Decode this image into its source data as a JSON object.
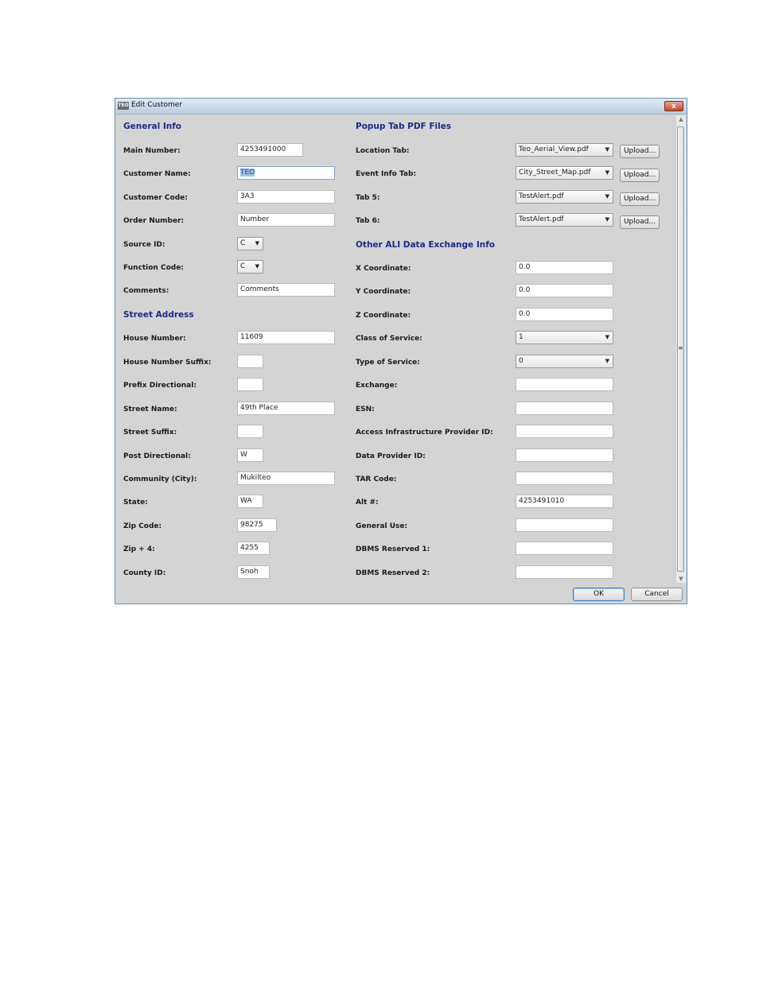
{
  "window": {
    "title": "Edit Customer",
    "icon_text": "TEO",
    "close": "x"
  },
  "general": {
    "heading": "General Info",
    "fields": [
      {
        "label": "Main Number:",
        "value": "4253491000"
      },
      {
        "label": "Customer Name:",
        "value": "TEO"
      },
      {
        "label": "Customer Code:",
        "value": "3A3"
      },
      {
        "label": "Order Number:",
        "value": "Number"
      },
      {
        "label": "Source ID:",
        "value": "C"
      },
      {
        "label": "Function Code:",
        "value": "C"
      },
      {
        "label": "Comments:",
        "value": "Comments"
      }
    ]
  },
  "street": {
    "heading": "Street Address",
    "fields": [
      {
        "label": "House Number:",
        "value": "11609"
      },
      {
        "label": "House Number Suffix:",
        "value": ""
      },
      {
        "label": "Prefix Directional:",
        "value": ""
      },
      {
        "label": "Street Name:",
        "value": "49th Place"
      },
      {
        "label": "Street Suffix:",
        "value": ""
      },
      {
        "label": "Post Directional:",
        "value": "W"
      },
      {
        "label": "Community (City):",
        "value": "Mukilteo"
      },
      {
        "label": "State:",
        "value": "WA"
      },
      {
        "label": "Zip Code:",
        "value": "98275"
      },
      {
        "label": "Zip + 4:",
        "value": "4255"
      },
      {
        "label": "County ID:",
        "value": "Snoh"
      }
    ]
  },
  "popup": {
    "heading": "Popup Tab PDF Files",
    "upload_label": "Upload...",
    "tabs": [
      {
        "label": "Location Tab:",
        "value": "Teo_Aerial_View.pdf"
      },
      {
        "label": "Event Info Tab:",
        "value": "City_Street_Map.pdf"
      },
      {
        "label": "Tab 5:",
        "value": "TestAlert.pdf"
      },
      {
        "label": "Tab 6:",
        "value": "TestAlert.pdf"
      }
    ]
  },
  "ali": {
    "heading": "Other ALI Data Exchange Info",
    "fields": [
      {
        "label": "X Coordinate:",
        "value": "0.0"
      },
      {
        "label": "Y Coordinate:",
        "value": "0.0"
      },
      {
        "label": "Z Coordinate:",
        "value": "0.0"
      },
      {
        "label": "Class of Service:",
        "value": "1"
      },
      {
        "label": "Type of Service:",
        "value": "0"
      },
      {
        "label": "Exchange:",
        "value": ""
      },
      {
        "label": "ESN:",
        "value": ""
      },
      {
        "label": "Access Infrastructure Provider ID:",
        "value": ""
      },
      {
        "label": "Data Provider ID:",
        "value": ""
      },
      {
        "label": "TAR Code:",
        "value": ""
      },
      {
        "label": "Alt #:",
        "value": "4253491010"
      },
      {
        "label": "General Use:",
        "value": ""
      },
      {
        "label": "DBMS Reserved 1:",
        "value": ""
      },
      {
        "label": "DBMS Reserved 2:",
        "value": ""
      }
    ]
  },
  "buttons": {
    "ok": "OK",
    "cancel": "Cancel"
  },
  "icons": {
    "dropdown": "chevron-down-icon",
    "close": "close-icon",
    "app": "app-icon"
  }
}
